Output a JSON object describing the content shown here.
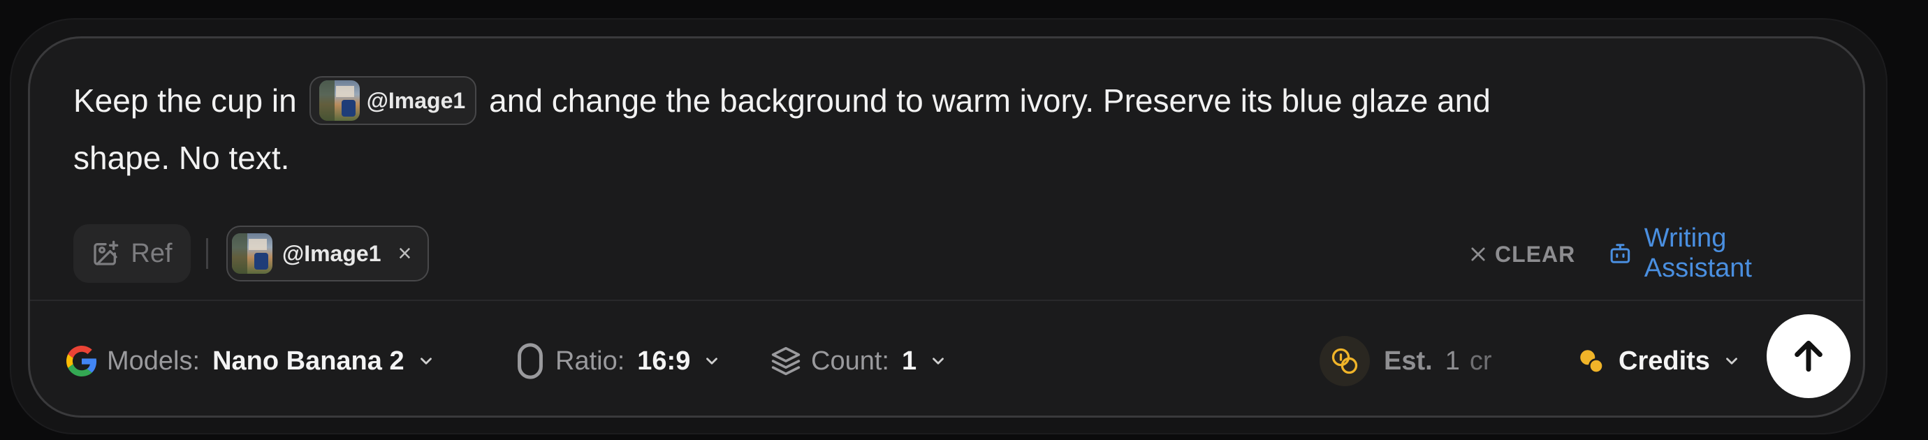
{
  "prompt": {
    "text_before": "Keep the cup in",
    "mention_label": "@Image1",
    "text_after_line1": "and change the background to warm ivory. Preserve its blue glaze and",
    "text_line2": "shape. No text."
  },
  "toolbar": {
    "ref_label": "Ref",
    "attachment_label": "@Image1",
    "attachment_remove": "×",
    "clear_label": "CLEAR",
    "writing_assistant_label": "Writing Assistant"
  },
  "bottom": {
    "models_label": "Models:",
    "models_value": "Nano Banana 2",
    "ratio_label": "Ratio:",
    "ratio_value": "16:9",
    "count_label": "Count:",
    "count_value": "1",
    "est_label": "Est.",
    "est_value": "1",
    "est_unit": "cr",
    "credits_label": "Credits"
  },
  "colors": {
    "accent_blue": "#4a8fe0",
    "coin_yellow": "#f0b429",
    "panel": "#1b1b1c"
  },
  "icons": [
    "image-plus-icon",
    "close-icon",
    "bot-icon",
    "google-logo-icon",
    "chevron-down-icon",
    "ratio-icon",
    "layers-icon",
    "coins-icon",
    "arrow-up-icon"
  ]
}
